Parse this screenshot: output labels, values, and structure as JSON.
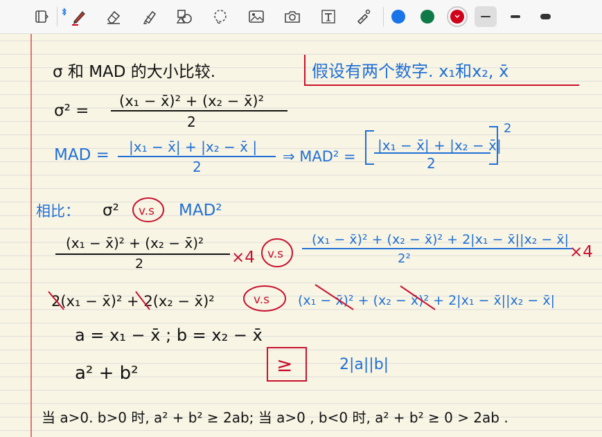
{
  "toolbar": {
    "tools": [
      {
        "name": "pages-icon"
      },
      {
        "name": "pen-icon",
        "active": true
      },
      {
        "name": "eraser-icon"
      },
      {
        "name": "highlighter-icon"
      },
      {
        "name": "shapes-icon"
      },
      {
        "name": "lasso-icon"
      },
      {
        "name": "image-icon"
      },
      {
        "name": "camera-icon"
      },
      {
        "name": "text-icon"
      },
      {
        "name": "laser-pointer-icon"
      }
    ],
    "bluetooth_icon": "bluetooth-icon",
    "colors": [
      "#1a73e8",
      "#0f7a48",
      "#d0021b"
    ],
    "selected_color": "#d0021b",
    "thickness_options": [
      "thin",
      "medium",
      "thick"
    ],
    "selected_thickness": "thin"
  },
  "notes": {
    "title": "σ 和 MAD 的大小比较.",
    "assumption": "假设有两个数字. x₁和x₂, x̄",
    "variance_lhs": "σ² =",
    "variance_num": "(x₁ − x̄)² + (x₂ − x̄)²",
    "variance_den": "2",
    "mad_lhs": "MAD =",
    "mad_num": "|x₁ − x̄| + |x₂ − x̄ |",
    "mad_den": "2",
    "mad_arrow": "⇒ MAD² =",
    "mad_sq_num": "|x₁ − x̄| + |x₂ − x̄|",
    "mad_sq_den": "2",
    "mad_sq_exp": "2",
    "compare_label": "相比：",
    "compare_sigma": "σ²",
    "vs": "v.s",
    "compare_mad": "MAD²",
    "row1_left_num": "(x₁ − x̄)² + (x₂ − x̄)²",
    "row1_left_den": "2",
    "times4": "×4",
    "row1_right_num": "(x₁ − x̄)² + (x₂ − x̄)² + 2|x₁ − x̄||x₂ − x̄|",
    "row1_right_den": "2²",
    "row2_left": "2(x₁ − x̄)² + 2(x₂ − x̄)²",
    "row2_right": "(x₁ − x̄)² + (x₂ − x̄)² + 2|x₁ − x̄||x₂ − x̄|",
    "define_ab": "a = x₁ − x̄ ;  b = x₂ − x̄",
    "sum_squares": "a² + b²",
    "geq_box": "≥",
    "two_ab": "2|a||b|",
    "conclusion": "当 a>0. b>0 时, a² + b² ≥ 2ab;  当 a>0 , b<0 时, a² + b² ≥ 0 > 2ab ."
  }
}
